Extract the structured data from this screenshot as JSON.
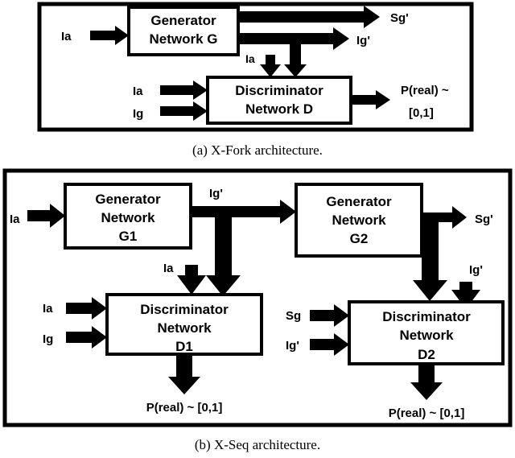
{
  "figure": {
    "title_a": "(a) X-Fork architecture.",
    "title_b": "(b) X-Seq architecture."
  },
  "panel_a": {
    "name": "X-Fork architecture",
    "blocks": [
      {
        "id": "G",
        "line1": "Generator",
        "line2": "Network G"
      },
      {
        "id": "D",
        "line1": "Discriminator",
        "line2": "Network D"
      }
    ],
    "labels": {
      "gen_input": "Ia",
      "out_sg": "Sg'",
      "out_ig": "Ig'",
      "disc_top_ia": "Ia",
      "disc_in_ia": "Ia",
      "disc_in_ig": "Ig",
      "disc_out_line1": "P(real) ~",
      "disc_out_line2": "[0,1]"
    }
  },
  "panel_b": {
    "name": "X-Seq architecture",
    "blocks": [
      {
        "id": "G1",
        "line1": "Generator",
        "line2": "Network",
        "line3": "G1"
      },
      {
        "id": "G2",
        "line1": "Generator",
        "line2": "Network",
        "line3": "G2"
      },
      {
        "id": "D1",
        "line1": "Discriminator",
        "line2": "Network",
        "line3": "D1"
      },
      {
        "id": "D2",
        "line1": "Discriminator",
        "line2": "Network",
        "line3": "D2"
      }
    ],
    "labels": {
      "g1_input": "Ia",
      "g1_output": "Ig'",
      "g2_output": "Sg'",
      "d1_top_ia": "Ia",
      "d1_in_ia": "Ia",
      "d1_in_ig": "Ig",
      "d1_out": "P(real) ~ [0,1]",
      "d2_top_ig": "Ig'",
      "d2_in_sg": "Sg",
      "d2_in_ig": "Ig'",
      "d2_out": "P(real) ~ [0,1]"
    }
  },
  "colors": {
    "ink": "#000000",
    "paper": "#ffffff"
  }
}
